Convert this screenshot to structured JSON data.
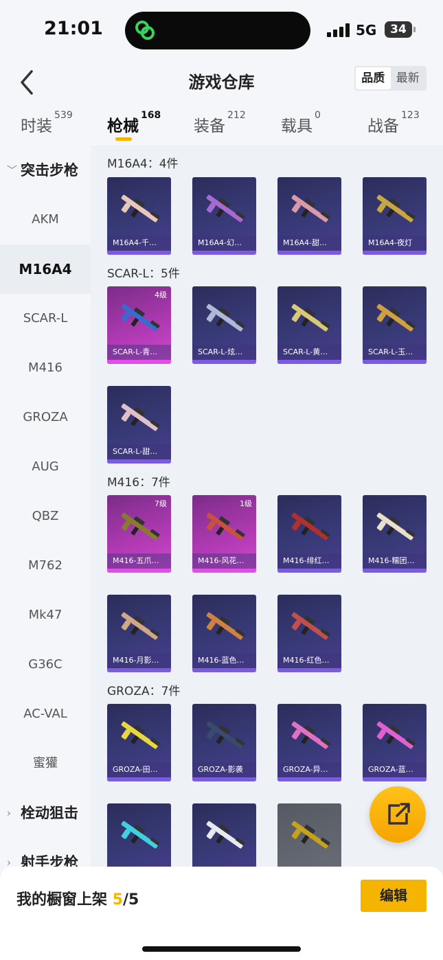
{
  "status": {
    "time": "21:01",
    "network": "5G",
    "battery": "34"
  },
  "header": {
    "title": "游戏仓库",
    "sort_options": [
      "品质",
      "最新"
    ]
  },
  "tabs": [
    {
      "label": "时装",
      "count": "539"
    },
    {
      "label": "枪械",
      "count": "168"
    },
    {
      "label": "装备",
      "count": "212"
    },
    {
      "label": "载具",
      "count": "0"
    },
    {
      "label": "战备",
      "count": "123"
    }
  ],
  "sidebar": {
    "category_top": "突击步枪",
    "items": [
      "AKM",
      "M16A4",
      "SCAR-L",
      "M416",
      "GROZA",
      "AUG",
      "QBZ",
      "M762",
      "Mk47",
      "G36C",
      "AC-VAL",
      "蜜獾"
    ],
    "category_bolt": "栓动狙击",
    "category_marksman": "射手步枪"
  },
  "groups": [
    {
      "title": "M16A4：4件",
      "items": [
        {
          "name": "M16A4-千…",
          "level": "",
          "style": "blue"
        },
        {
          "name": "M16A4-幻…",
          "level": "",
          "style": "blue"
        },
        {
          "name": "M16A4-甜…",
          "level": "",
          "style": "blue"
        },
        {
          "name": "M16A4-夜灯",
          "level": "",
          "style": "blue"
        }
      ]
    },
    {
      "title": "SCAR-L：5件",
      "items": [
        {
          "name": "SCAR-L-青…",
          "level": "4级",
          "style": "pink"
        },
        {
          "name": "SCAR-L-炫…",
          "level": "",
          "style": "blue"
        },
        {
          "name": "SCAR-L-黄…",
          "level": "",
          "style": "blue"
        },
        {
          "name": "SCAR-L-玉…",
          "level": "",
          "style": "blue"
        },
        {
          "name": "SCAR-L-甜…",
          "level": "",
          "style": "blue"
        }
      ]
    },
    {
      "title": "M416：7件",
      "items": [
        {
          "name": "M416-五爪…",
          "level": "7级",
          "style": "pink"
        },
        {
          "name": "M416-风花…",
          "level": "1级",
          "style": "pink"
        },
        {
          "name": "M416-绯红…",
          "level": "",
          "style": "blue"
        },
        {
          "name": "M416-糯团…",
          "level": "",
          "style": "blue"
        },
        {
          "name": "M416-月影…",
          "level": "",
          "style": "blue"
        },
        {
          "name": "M416-蓝色…",
          "level": "",
          "style": "blue"
        },
        {
          "name": "M416-红色…",
          "level": "",
          "style": "blue"
        }
      ]
    },
    {
      "title": "GROZA：7件",
      "items": [
        {
          "name": "GROZA-田…",
          "level": "",
          "style": "blue"
        },
        {
          "name": "GROZA-影袭",
          "level": "",
          "style": "blue"
        },
        {
          "name": "GROZA-异…",
          "level": "",
          "style": "blue"
        },
        {
          "name": "GROZA-蓝…",
          "level": "",
          "style": "blue"
        },
        {
          "name": "",
          "level": "",
          "style": "blue"
        },
        {
          "name": "",
          "level": "",
          "style": "blue"
        },
        {
          "name": "",
          "level": "",
          "style": "gray"
        }
      ]
    }
  ],
  "bottom": {
    "showcase_label": "我的橱窗上架",
    "showcase_current": "5",
    "showcase_total": "/5",
    "edit_label": "编辑"
  },
  "colors": {
    "accent": "#f5b400",
    "card_blue": "#383a78",
    "card_pink": "#b33ab5"
  }
}
